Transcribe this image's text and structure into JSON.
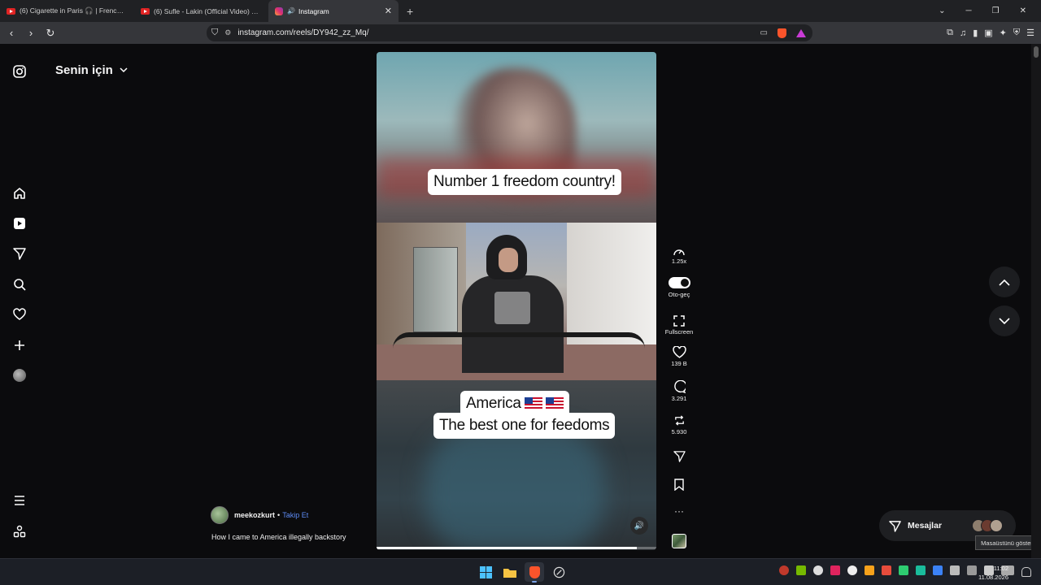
{
  "browser": {
    "tabs": [
      {
        "label": "(6) Cigarette in Paris 🎧 | French Emo",
        "icon": "youtube-icon"
      },
      {
        "label": "(6) Sufle - Lakin (Official Video) - You",
        "icon": "youtube-icon"
      },
      {
        "label": "Instagram",
        "icon": "instagram-icon",
        "active": true
      }
    ],
    "new_tab": "+",
    "url": "instagram.com/reels/DY942_zz_Mq/"
  },
  "sidebar": {
    "title": "Senin için",
    "title_chevron": "chevron-down-icon"
  },
  "reel": {
    "caption_top": "Number 1 freedom country!",
    "caption_mid_line1": "America",
    "caption_mid_line2": "The best one for feedoms",
    "progress": 0.93,
    "username": "meekozkurt",
    "separator": "•",
    "follow_label": "Takip Et",
    "description": "How I came to America illegally backstory"
  },
  "actions": {
    "speed": "1.25x",
    "autoplay": "Oto-geç",
    "fullscreen": "Fullscreen",
    "likes": "139 B",
    "comments": "3.291",
    "reposts": "5.930",
    "more": "···"
  },
  "messages": {
    "label": "Mesajlar",
    "tooltip": "Masaüstünü göster"
  },
  "taskbar": {
    "time": "11:02",
    "date": "11.08.2026"
  },
  "colors": {
    "accent_link": "#5d8bf4",
    "brave": "#fb542b"
  }
}
